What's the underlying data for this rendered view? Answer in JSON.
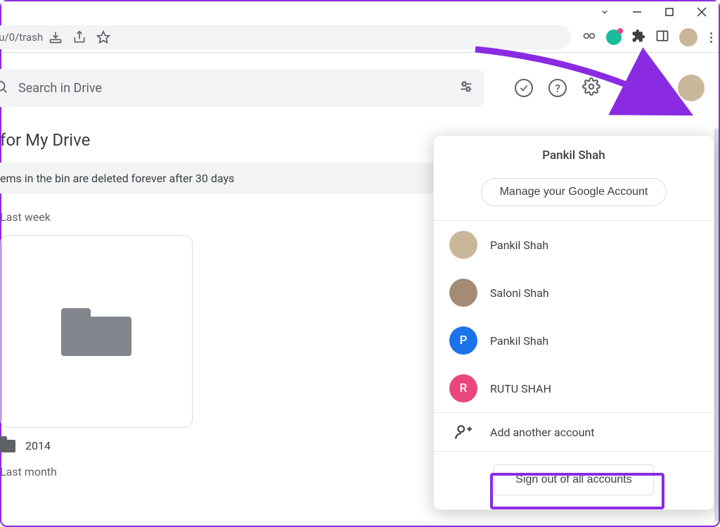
{
  "url_path": "/u/0/trash",
  "search": {
    "placeholder": "Search in Drive"
  },
  "page": {
    "title_fragment": "for My Drive",
    "banner_text_fragment": "ems in the bin are deleted forever after 30 days"
  },
  "sections": {
    "last_week": "Last week",
    "last_month": "Last month"
  },
  "file": {
    "name": "2014"
  },
  "popup": {
    "current_name": "Pankil Shah",
    "manage_label": "Manage your Google Account",
    "accounts": [
      {
        "name": "Pankil Shah",
        "avatar_bg": "#c9b79a",
        "initial": ""
      },
      {
        "name": "Saloni Shah",
        "avatar_bg": "#a38b76",
        "initial": ""
      },
      {
        "name": "Pankil Shah",
        "avatar_bg": "#1a73e8",
        "initial": "P"
      },
      {
        "name": "RUTU SHAH",
        "avatar_bg": "#e8467c",
        "initial": "R"
      }
    ],
    "add_label": "Add another account",
    "signout_label": "Sign out of all accounts"
  }
}
